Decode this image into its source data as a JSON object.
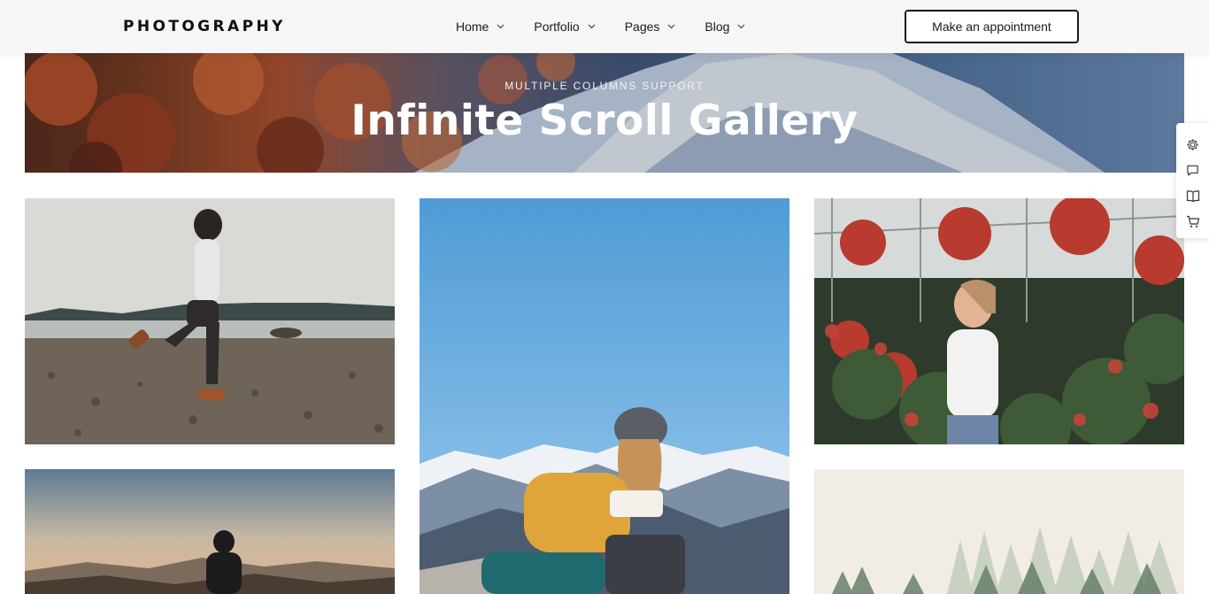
{
  "header": {
    "logo": "PHOTOGRAPHY",
    "nav": [
      {
        "label": "Home",
        "icon": "chevron-down-icon"
      },
      {
        "label": "Portfolio",
        "icon": "chevron-down-icon"
      },
      {
        "label": "Pages",
        "icon": "chevron-down-icon"
      },
      {
        "label": "Blog",
        "icon": "chevron-down-icon"
      }
    ],
    "cta_label": "Make an appointment"
  },
  "hero": {
    "eyebrow": "MULTIPLE COLUMNS SUPPORT",
    "title": "Infinite Scroll Gallery"
  },
  "gallery": {
    "tiles": [
      {
        "scene": "woman running on rocky beach"
      },
      {
        "scene": "hiker writing in notebook before snowy mountains"
      },
      {
        "scene": "woman among flowers in greenhouse"
      },
      {
        "scene": "man silhouetted against sunset hills"
      },
      {
        "scene": "misty pine forest"
      }
    ]
  },
  "side_panel": {
    "icons": [
      "gear-icon",
      "chat-icon",
      "book-icon",
      "cart-icon"
    ]
  },
  "colors": {
    "header_bg": "#f6f6f6",
    "text": "#1a1a1a",
    "accent_border": "#1a1a1a"
  }
}
